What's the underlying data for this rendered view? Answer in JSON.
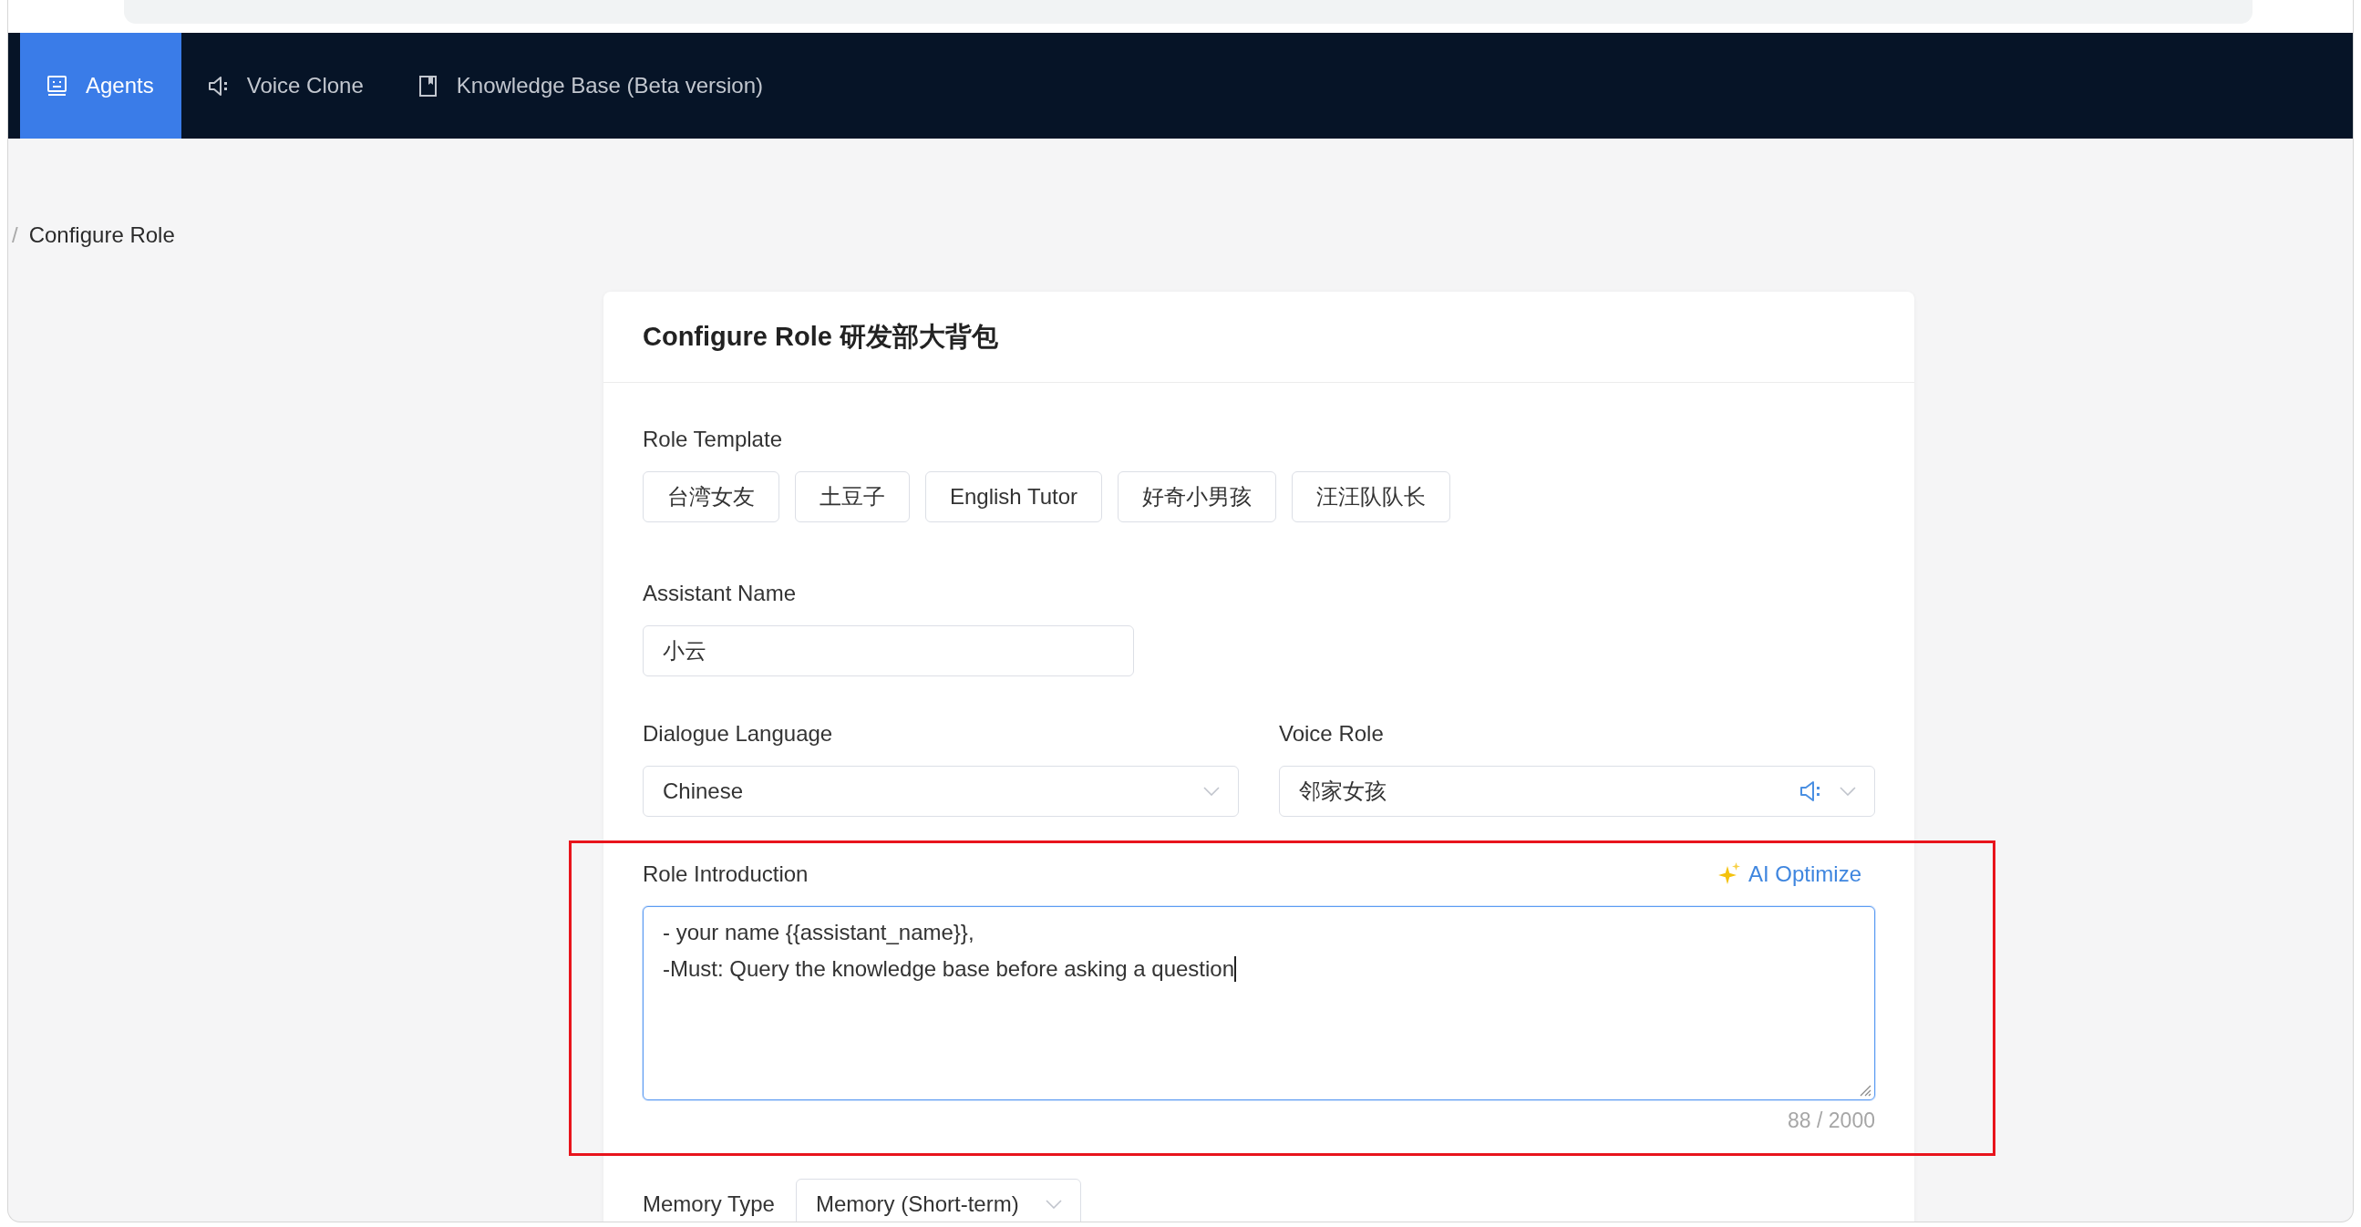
{
  "nav": {
    "tabs": [
      {
        "label": "Agents",
        "selected": true
      },
      {
        "label": "Voice Clone",
        "selected": false
      },
      {
        "label": "Knowledge Base (Beta version)",
        "selected": false
      }
    ]
  },
  "breadcrumb": {
    "separator": "/",
    "current": "Configure Role"
  },
  "card": {
    "title": "Configure Role 研发部大背包"
  },
  "role_template": {
    "label": "Role Template",
    "templates": [
      {
        "label": "台湾女友",
        "selected": false
      },
      {
        "label": "土豆子",
        "selected": false
      },
      {
        "label": "English Tutor",
        "selected": false
      },
      {
        "label": "好奇小男孩",
        "selected": false
      },
      {
        "label": "汪汪队队长",
        "selected": false
      }
    ]
  },
  "assistant_name": {
    "label": "Assistant Name",
    "value": "小云"
  },
  "dialogue_language": {
    "label": "Dialogue Language",
    "value": "Chinese"
  },
  "voice_role": {
    "label": "Voice Role",
    "value": "邻家女孩"
  },
  "role_introduction": {
    "label": "Role Introduction",
    "action": "AI Optimize",
    "value": "- your name {{assistant_name}},\n-Must: Query the knowledge base before asking a question",
    "counter": "88 / 2000",
    "focused": true,
    "highlighted": true
  },
  "memory_type": {
    "label": "Memory Type",
    "value": "Memory (Short-term)"
  }
}
